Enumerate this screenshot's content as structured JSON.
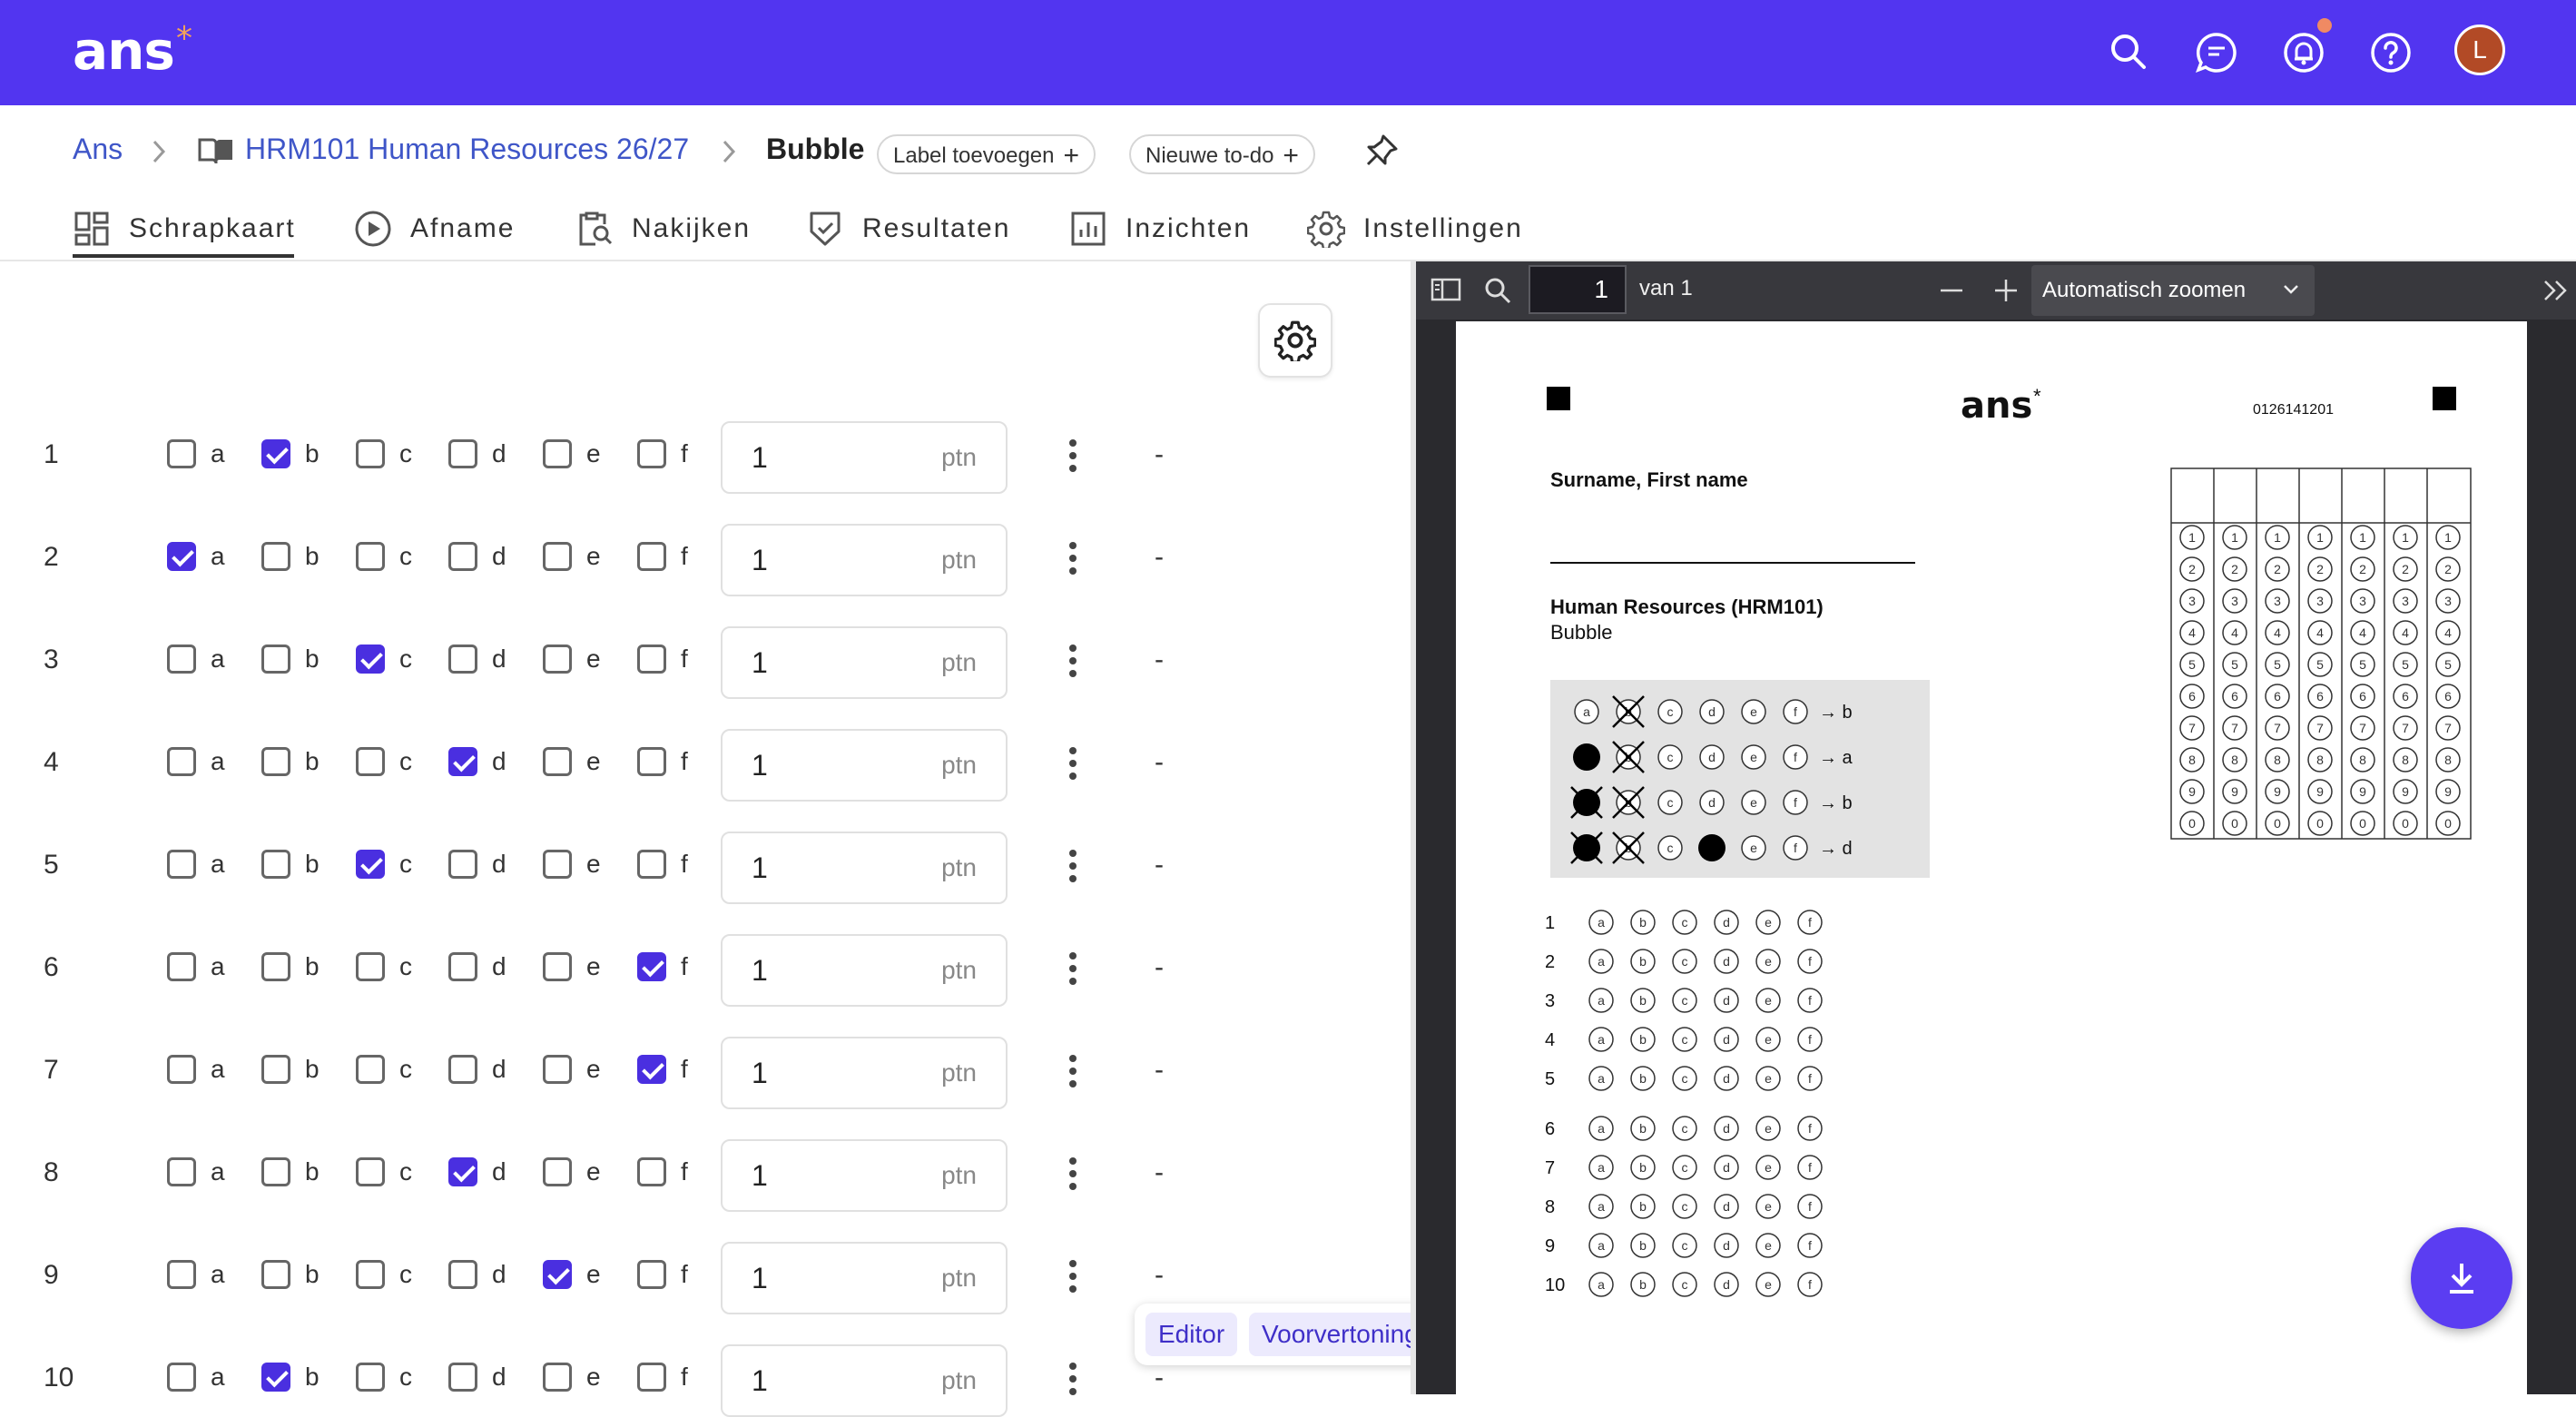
{
  "header": {
    "logo": "ans",
    "logo_star": "*",
    "avatar_initial": "L"
  },
  "breadcrumb": {
    "root": "Ans",
    "course": "HRM101 Human Resources 26/27",
    "current": "Bubble",
    "label_button": "Label toevoegen",
    "todo_button": "Nieuwe to-do"
  },
  "tabs": [
    {
      "label": "Schrapkaart",
      "active": true
    },
    {
      "label": "Afname"
    },
    {
      "label": "Nakijken"
    },
    {
      "label": "Resultaten"
    },
    {
      "label": "Inzichten"
    },
    {
      "label": "Instellingen"
    }
  ],
  "questions": [
    {
      "num": "1",
      "correct": "b",
      "points": "1",
      "unit": "ptn",
      "status": "-"
    },
    {
      "num": "2",
      "correct": "a",
      "points": "1",
      "unit": "ptn",
      "status": "-"
    },
    {
      "num": "3",
      "correct": "c",
      "points": "1",
      "unit": "ptn",
      "status": "-"
    },
    {
      "num": "4",
      "correct": "d",
      "points": "1",
      "unit": "ptn",
      "status": "-"
    },
    {
      "num": "5",
      "correct": "c",
      "points": "1",
      "unit": "ptn",
      "status": "-"
    },
    {
      "num": "6",
      "correct": "f",
      "points": "1",
      "unit": "ptn",
      "status": "-"
    },
    {
      "num": "7",
      "correct": "f",
      "points": "1",
      "unit": "ptn",
      "status": "-"
    },
    {
      "num": "8",
      "correct": "d",
      "points": "1",
      "unit": "ptn",
      "status": "-"
    },
    {
      "num": "9",
      "correct": "e",
      "points": "1",
      "unit": "ptn",
      "status": "-"
    },
    {
      "num": "10",
      "correct": "b",
      "points": "1",
      "unit": "ptn",
      "status": "-"
    }
  ],
  "option_letters": [
    "a",
    "b",
    "c",
    "d",
    "e",
    "f"
  ],
  "view_toggle": {
    "editor": "Editor",
    "preview": "Voorvertoning"
  },
  "pdf": {
    "page_input": "1",
    "page_total": "van 1",
    "zoom": "Automatisch zoomen",
    "sheet": {
      "logo": "ans",
      "logo_star": "*",
      "code": "0126141201",
      "name_label": "Surname, First name",
      "course_title": "Human Resources (HRM101)",
      "test_name": "Bubble",
      "examples": [
        {
          "marks": [
            "a-empty",
            "b-cross",
            "c",
            "d",
            "e",
            "f"
          ],
          "result": "→ b"
        },
        {
          "marks": [
            "a-fill",
            "b-cross",
            "c",
            "d",
            "e",
            "f"
          ],
          "result": "→ a"
        },
        {
          "marks": [
            "a-fillcross",
            "b-cross",
            "c",
            "d",
            "e",
            "f"
          ],
          "result": "→ b"
        },
        {
          "marks": [
            "a-fillcross",
            "b-cross",
            "c",
            "d-fill",
            "e",
            "f"
          ],
          "result": "→ d"
        }
      ],
      "answer_rows": [
        "1",
        "2",
        "3",
        "4",
        "5",
        "6",
        "7",
        "8",
        "9",
        "10"
      ],
      "id_digits": [
        "1",
        "2",
        "3",
        "4",
        "5",
        "6",
        "7",
        "8",
        "9",
        "0"
      ]
    }
  },
  "colors": {
    "brand": "#5235f0",
    "accent_star": "#f3a25b",
    "checkbox_checked": "#4a2fe0",
    "link": "#3f56c8",
    "avatar": "#b24a26",
    "pdf_toolbar": "#38383d",
    "pdf_background": "#2a2a2e"
  },
  "icons": [
    "search-icon",
    "comments-icon",
    "notifications-icon",
    "help-icon",
    "book-icon",
    "pin-icon",
    "grid-icon",
    "play-icon",
    "review-icon",
    "shield-check-icon",
    "chart-icon",
    "gear-icon",
    "sidebar-toggle-icon",
    "download-icon"
  ]
}
